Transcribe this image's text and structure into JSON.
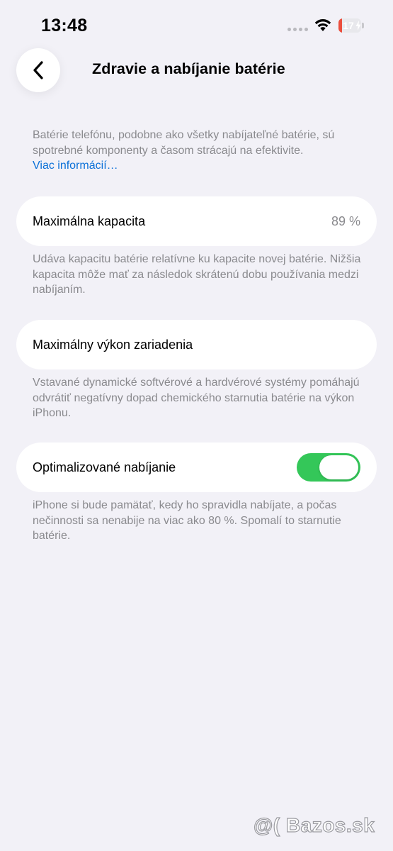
{
  "status_bar": {
    "time": "13:48",
    "battery_level": "17",
    "battery_fraction": 0.17,
    "battery_color": "#eb4e3d"
  },
  "header": {
    "back_icon": "chevron-left-icon",
    "title": "Zdravie a nabíjanie batérie"
  },
  "intro": {
    "text": "Batérie telefónu, podobne ako všetky nabíjateľné batérie, sú spotrebné komponenty a časom strácajú na efektivite.",
    "link": "Viac informácií…",
    "link_color": "#0a70d8"
  },
  "capacity": {
    "label": "Maximálna kapacita",
    "value": "89 %",
    "description": "Udáva kapacitu batérie relatívne ku kapacite novej batérie. Nižšia kapacita môže mať za následok skrátenú dobu používania medzi nabíjaním."
  },
  "performance": {
    "label": "Maximálny výkon zariadenia",
    "description": "Vstavané dynamické softvérové a hardvérové systémy pomáhajú odvrátiť negatívny dopad chemického starnutia batérie na výkon iPhonu."
  },
  "optimized_charging": {
    "label": "Optimalizované nabíjanie",
    "enabled": true,
    "toggle_color": "#34c759",
    "description": "iPhone si bude pamätať, kedy ho spravidla nabíjate, a počas nečinnosti sa nenabije na viac ako 80 %. Spomalí to starnutie batérie."
  },
  "watermark": {
    "text": "@( Bazos.sk"
  }
}
